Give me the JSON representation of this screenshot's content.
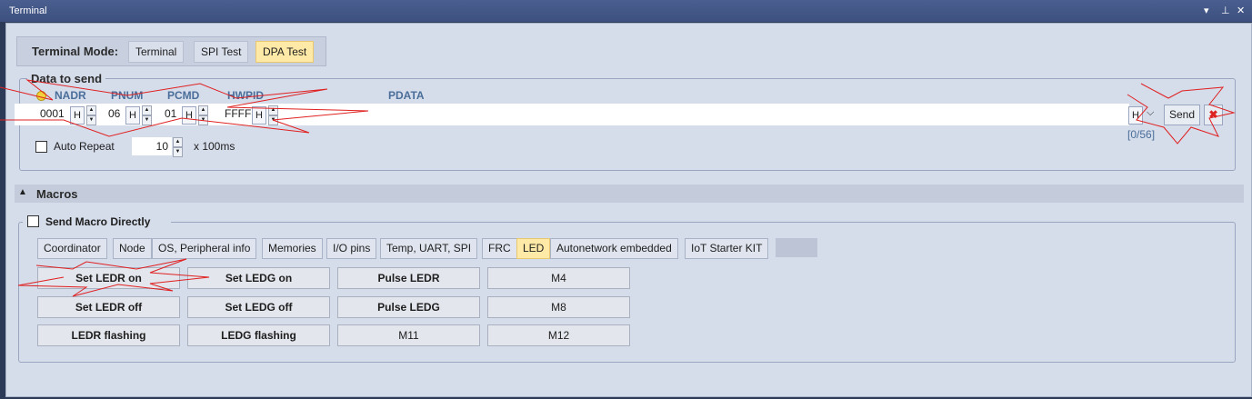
{
  "window": {
    "title": "Terminal",
    "controls": [
      "▾",
      "⊥",
      "✕"
    ]
  },
  "mode": {
    "label": "Terminal Mode:",
    "options": [
      "Terminal",
      "SPI Test",
      "DPA Test"
    ],
    "active": "DPA Test"
  },
  "data_to_send": {
    "legend": "Data to send",
    "columns": {
      "nadr": "NADR",
      "pnum": "PNUM",
      "pcmd": "PCMD",
      "hwpid": "HWPID",
      "pdata": "PDATA"
    },
    "values": {
      "nadr": "0001",
      "pnum": "06",
      "pcmd": "01",
      "hwpid": "FFFF",
      "pdata": ""
    },
    "hex_suffix": "H",
    "send_label": "Send",
    "counter": "[0/56]",
    "auto_repeat": {
      "label": "Auto Repeat",
      "checked": false,
      "value": "10",
      "unit": "x 100ms"
    }
  },
  "macros": {
    "section_label": "Macros",
    "send_directly_label": "Send Macro Directly",
    "tabs": [
      "Coordinator",
      "Node",
      "OS, Peripheral info",
      "Memories",
      "I/O pins",
      "Temp, UART, SPI",
      "FRC",
      "LED",
      "Autonetwork embedded",
      "IoT Starter KIT"
    ],
    "active_tab": "LED",
    "buttons": [
      [
        "Set LEDR on",
        "Set LEDG on",
        "Pulse LEDR",
        "M4"
      ],
      [
        "Set LEDR off",
        "Set LEDG off",
        "Pulse LEDG",
        "M8"
      ],
      [
        "LEDR flashing",
        "LEDG flashing",
        "M11",
        "M12"
      ]
    ]
  },
  "colors": {
    "active_tab": "#ffe9a6",
    "panel": "#d5dcea",
    "titlebar": "#3d5080",
    "annotation": "#e02020"
  }
}
